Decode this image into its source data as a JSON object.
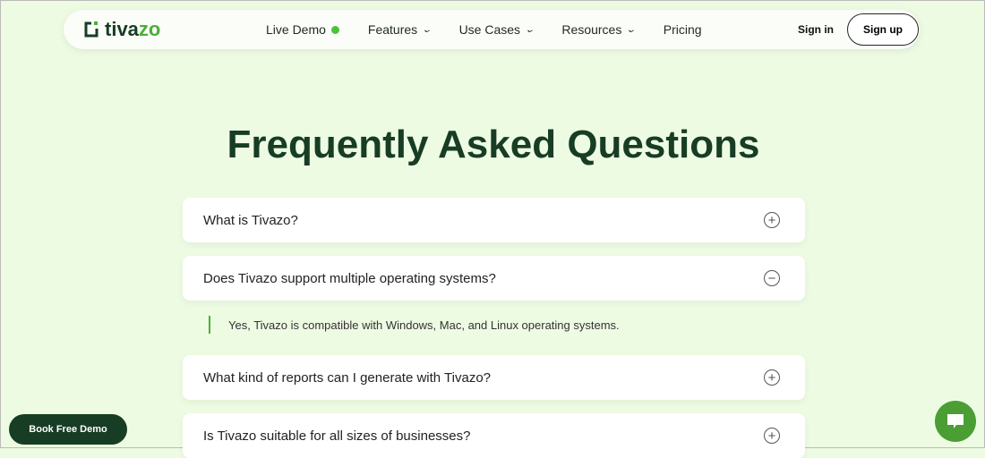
{
  "nav": {
    "logo_a": "tiva",
    "logo_b": "zo",
    "items": [
      "Live Demo",
      "Features",
      "Use Cases",
      "Resources",
      "Pricing"
    ],
    "sign_in": "Sign in",
    "sign_up": "Sign up"
  },
  "title": "Frequently Asked Questions",
  "faqs": [
    {
      "q": "What is Tivazo?",
      "state": "collapsed"
    },
    {
      "q": "Does Tivazo support multiple operating systems?",
      "state": "expanded",
      "a": "Yes, Tivazo is compatible with Windows, Mac, and Linux operating systems."
    },
    {
      "q": "What kind of reports can I generate with Tivazo?",
      "state": "collapsed"
    },
    {
      "q": "Is Tivazo suitable for all sizes of businesses?",
      "state": "collapsed"
    }
  ],
  "icons": {
    "plus": "+",
    "minus": "−"
  },
  "book_demo": "Book Free Demo"
}
